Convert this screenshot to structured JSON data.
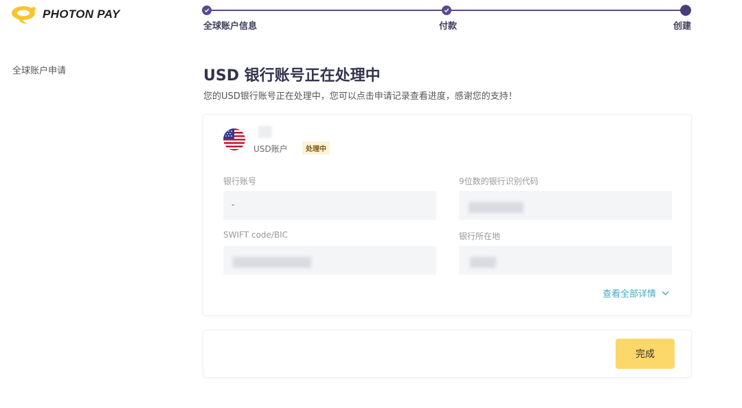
{
  "brand": {
    "name": "PHOTON PAY",
    "accent": "#f7c62f"
  },
  "sidebar": {
    "items": [
      {
        "label": "全球账户申请"
      }
    ]
  },
  "stepper": {
    "color": "#5b4a8b",
    "steps": [
      {
        "label": "全球账户信息",
        "state": "completed"
      },
      {
        "label": "付款",
        "state": "completed"
      },
      {
        "label": "创建",
        "state": "current"
      }
    ]
  },
  "main": {
    "title": "USD 银行账号正在处理中",
    "subtitle": "您的USD银行账号正在处理中，您可以点击申请记录查看进度，感谢您的支持！"
  },
  "account": {
    "flag_icon": "us-flag-icon",
    "type": "USD账户",
    "status": "处理中",
    "fields": {
      "bank_account": {
        "label": "银行账号",
        "value": "-"
      },
      "routing_code": {
        "label": "9位数的银行识别代码"
      },
      "swift": {
        "label": "SWIFT code/BIC"
      },
      "bank_location": {
        "label": "银行所在地"
      }
    },
    "details_link": "查看全部详情"
  },
  "actions": {
    "done_label": "完成",
    "done_color": "#fcd76a"
  }
}
